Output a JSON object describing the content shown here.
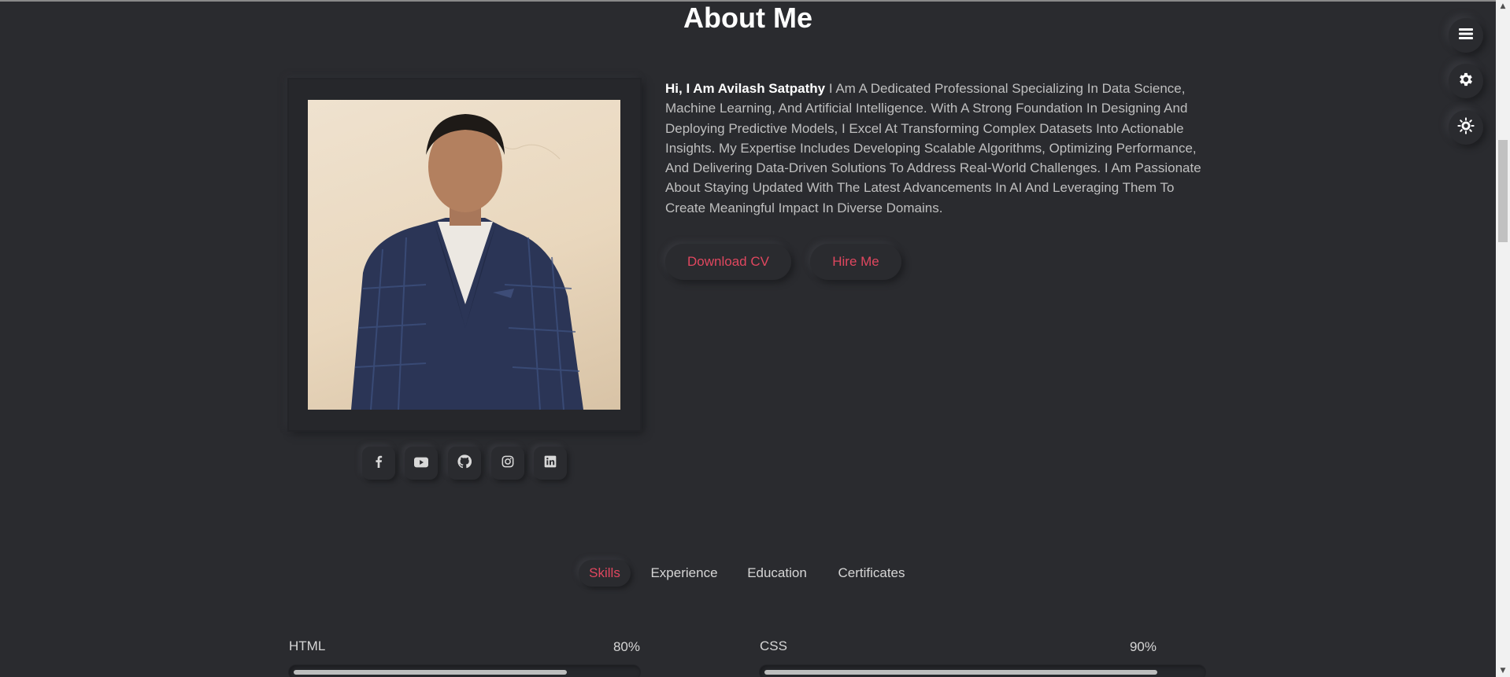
{
  "section": {
    "title": "About Me"
  },
  "about": {
    "greeting": "Hi, I Am Avilash Satpathy",
    "body": " I Am A Dedicated Professional Specializing In Data Science, Machine Learning, And Artificial Intelligence. With A Strong Foundation In Designing And Deploying Predictive Models, I Excel At Transforming Complex Datasets Into Actionable Insights. My Expertise Includes Developing Scalable Algorithms, Optimizing Performance, And Delivering Data-Driven Solutions To Address Real-World Challenges. I Am Passionate About Staying Updated With The Latest Advancements In AI And Leveraging Them To Create Meaningful Impact In Diverse Domains.",
    "buttons": {
      "download_cv": "Download CV",
      "hire_me": "Hire Me"
    }
  },
  "social": [
    "facebook-icon",
    "youtube-icon",
    "github-icon",
    "instagram-icon",
    "linkedin-icon"
  ],
  "floating": [
    "menu-icon",
    "gear-icon",
    "theme-icon"
  ],
  "tabs": [
    {
      "label": "Skills",
      "active": true
    },
    {
      "label": "Experience",
      "active": false
    },
    {
      "label": "Education",
      "active": false
    },
    {
      "label": "Certificates",
      "active": false
    }
  ],
  "skills": [
    {
      "name": "HTML",
      "percent": "80%",
      "value": 0.8
    },
    {
      "name": "CSS",
      "percent": "90%",
      "value": 0.9
    }
  ],
  "colors": {
    "accent": "#e0475f",
    "background": "#2a2b2f"
  }
}
